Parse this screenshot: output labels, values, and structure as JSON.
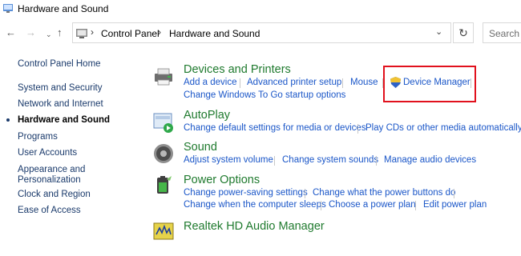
{
  "window": {
    "title": "Hardware and Sound"
  },
  "address": {
    "crumbs": [
      "Control Panel",
      "Hardware and Sound"
    ],
    "search_placeholder": "Search C"
  },
  "sidebar": {
    "items": [
      {
        "label": "Control Panel Home"
      },
      {
        "label": "System and Security"
      },
      {
        "label": "Network and Internet"
      },
      {
        "label": "Hardware and Sound",
        "active": true
      },
      {
        "label": "Programs"
      },
      {
        "label": "User Accounts"
      },
      {
        "label": "Appearance and"
      },
      {
        "label": "Personalization"
      },
      {
        "label": "Clock and Region"
      },
      {
        "label": "Ease of Access"
      }
    ]
  },
  "categories": {
    "devices": {
      "title": "Devices and Printers",
      "links": [
        "Add a device",
        "Advanced printer setup",
        "Mouse",
        "Device Manager",
        "Change Windows To Go startup options"
      ]
    },
    "autoplay": {
      "title": "AutoPlay",
      "links": [
        "Change default settings for media or devices",
        "Play CDs or other media automatically"
      ]
    },
    "sound": {
      "title": "Sound",
      "links": [
        "Adjust system volume",
        "Change system sounds",
        "Manage audio devices"
      ]
    },
    "power": {
      "title": "Power Options",
      "links": [
        "Change power-saving settings",
        "Change what the power buttons do",
        "Change when the computer sleeps",
        "Choose a power plan",
        "Edit power plan"
      ]
    },
    "realtek": {
      "title": "Realtek HD Audio Manager"
    }
  },
  "colors": {
    "category_title": "#1f7a2e",
    "link": "#1a56c8",
    "highlight": "#e1111d"
  }
}
